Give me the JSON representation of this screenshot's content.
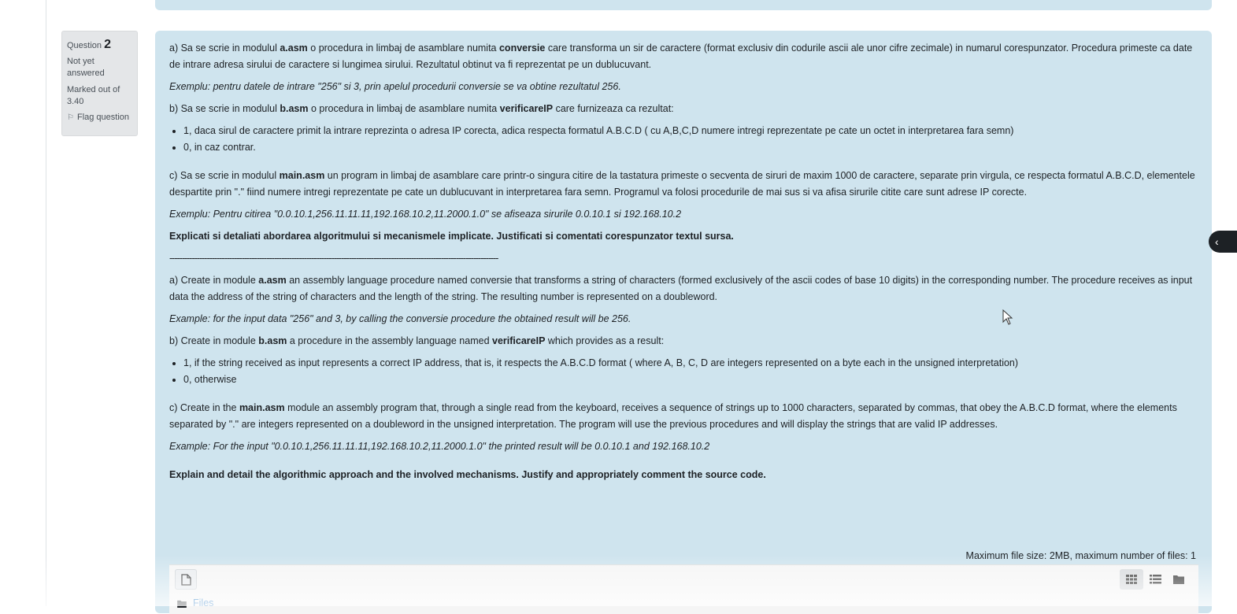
{
  "question": {
    "label": "Question",
    "number": "2",
    "state": "Not yet answered",
    "grade": "Marked out of 3.40",
    "flag": "Flag question"
  },
  "ro": {
    "a_pre": "a) Sa se scrie in modulul ",
    "a_module": "a.asm",
    "a_mid": " o procedura in limbaj de asamblare numita ",
    "a_name": "conversie",
    "a_post": " care transforma un sir de caractere (format exclusiv din codurile ascii ale unor cifre zecimale) in numarul corespunzator. Procedura primeste ca date de intrare adresa sirului de caractere si lungimea sirului. Rezultatul obtinut va fi reprezentat pe un dublucuvant.",
    "a_example": "Exemplu: pentru datele de intrare \"256\" si 3, prin apelul procedurii conversie se va obtine rezultatul 256.",
    "b_pre": "b) Sa se scrie in modulul ",
    "b_module": "b.asm",
    "b_mid": " o procedura in limbaj de asamblare numita ",
    "b_name": "verificareIP",
    "b_post": " care furnizeaza ca rezultat:",
    "b_item1": "1, daca sirul de caractere primit la intrare reprezinta o adresa IP corecta, adica respecta formatul A.B.C.D ( cu A,B,C,D numere intregi reprezentate pe cate un octet in interpretarea fara semn)",
    "b_item2": "0, in caz contrar.",
    "c_pre": "c) Sa se scrie in modulul ",
    "c_module": "main.asm",
    "c_post": " un program in limbaj de asamblare care printr-o singura citire de la tastatura primeste o secventa de siruri de maxim 1000 de caractere, separate prin virgula, ce respecta formatul A.B.C.D, elementele despartite prin \".\" fiind numere intregi reprezentate pe cate un dublucuvant in interpretarea fara semn. Programul va folosi procedurile de mai sus si va afisa sirurile citite care sunt adrese IP corecte.",
    "c_example": "Exemplu: Pentru citirea \"0.0.10.1,256.11.11.11,192.168.10.2,11.2000.1.0\" se afiseaza sirurile 0.0.10.1 si 192.168.10.2",
    "instructions": "Explicati si detaliati abordarea algoritmului si mecanismele implicate. Justificati si comentati corespunzator textul sursa."
  },
  "separator": "------------------------------------------------------------------------------------------------------------------------------------",
  "en": {
    "a_pre": "a) Create in module ",
    "a_module": "a.asm",
    "a_post": " an assembly language procedure named conversie that transforms a string of characters (formed exclusively of the ascii codes of base 10 digits) in the corresponding number. The procedure receives as input data the address of the string of characters and the length of the string. The resulting number is represented on a doubleword.",
    "a_example": "Example: for the input data \"256\" and 3, by calling the conversie procedure the obtained result will be 256.",
    "b_pre": "b) Create in module ",
    "b_module": "b.asm",
    "b_mid": " a procedure in the assembly language named ",
    "b_name": "verificareIP",
    "b_post": " which provides as a result:",
    "b_item1": "1, if the string received as input represents a correct IP address, that is, it respects the A.B.C.D format ( where A, B, C, D are integers represented on a byte each in the unsigned interpretation)",
    "b_item2": "0, otherwise",
    "c_pre": "c) Create in the ",
    "c_module": "main.asm",
    "c_post": " module an assembly program that, through a single read from the keyboard, receives a sequence of strings up to 1000 characters, separated by commas, that obey the A.B.C.D format, where the elements separated by \".\" are integers represented on a doubleword in the unsigned interpretation. The program will use the previous procedures and will display the strings that are valid IP addresses.",
    "c_example": "Example: For the input \"0.0.10.1,256.11.11.11,192.168.10.2,11.2000.1.0\" the printed result will be 0.0.10.1 and 192.168.10.2",
    "instructions": "Explain and detail the algorithmic approach and the involved mechanisms. Justify and appropriately comment the source code."
  },
  "filepicker": {
    "max_info": "Maximum file size: 2MB, maximum number of files: 1",
    "files_label": "Files",
    "add_icon": "file-icon",
    "views": [
      "grid-view-icon",
      "list-view-icon",
      "folder-view-icon"
    ]
  },
  "colors": {
    "panel": "#cfe4ee",
    "info": "#e4e6e8",
    "link": "#0f6cbf"
  }
}
